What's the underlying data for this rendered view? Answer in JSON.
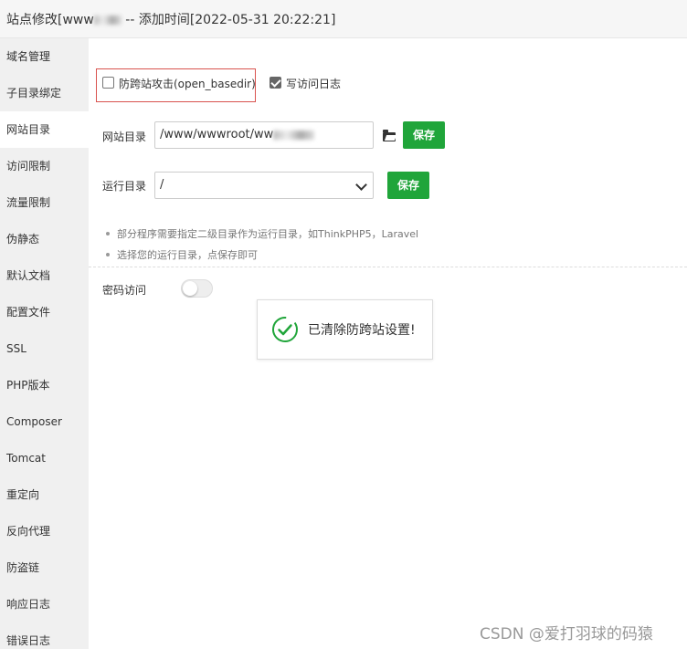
{
  "title": {
    "prefix": "站点修改[www",
    "suffix": " -- 添加时间[2022-05-31 20:22:21]"
  },
  "sidebar": {
    "items": [
      {
        "label": "域名管理",
        "active": false
      },
      {
        "label": "子目录绑定",
        "active": false
      },
      {
        "label": "网站目录",
        "active": true
      },
      {
        "label": "访问限制",
        "active": false
      },
      {
        "label": "流量限制",
        "active": false
      },
      {
        "label": "伪静态",
        "active": false
      },
      {
        "label": "默认文档",
        "active": false
      },
      {
        "label": "配置文件",
        "active": false
      },
      {
        "label": "SSL",
        "active": false
      },
      {
        "label": "PHP版本",
        "active": false
      },
      {
        "label": "Composer",
        "active": false
      },
      {
        "label": "Tomcat",
        "active": false
      },
      {
        "label": "重定向",
        "active": false
      },
      {
        "label": "反向代理",
        "active": false
      },
      {
        "label": "防盗链",
        "active": false
      },
      {
        "label": "响应日志",
        "active": false
      },
      {
        "label": "错误日志",
        "active": false
      }
    ]
  },
  "options": {
    "anti_xss": {
      "label": "防跨站攻击(open_basedir)",
      "checked": false
    },
    "access_log": {
      "label": "写访问日志",
      "checked": true
    }
  },
  "site_dir": {
    "label": "网站目录",
    "value": "/www/wwwroot/ww",
    "save_label": "保存"
  },
  "run_dir": {
    "label": "运行目录",
    "selected": "/",
    "save_label": "保存"
  },
  "tips": [
    "部分程序需要指定二级目录作为运行目录，如ThinkPHP5，Laravel",
    "选择您的运行目录，点保存即可"
  ],
  "password_access": {
    "label": "密码访问",
    "enabled": false
  },
  "toast": {
    "message": "已清除防跨站设置!"
  },
  "watermark": "CSDN @爱打羽球的码猿",
  "colors": {
    "accent": "#20a53a",
    "highlight_border": "#d9534f",
    "sidebar_bg": "#f0f0f0"
  }
}
